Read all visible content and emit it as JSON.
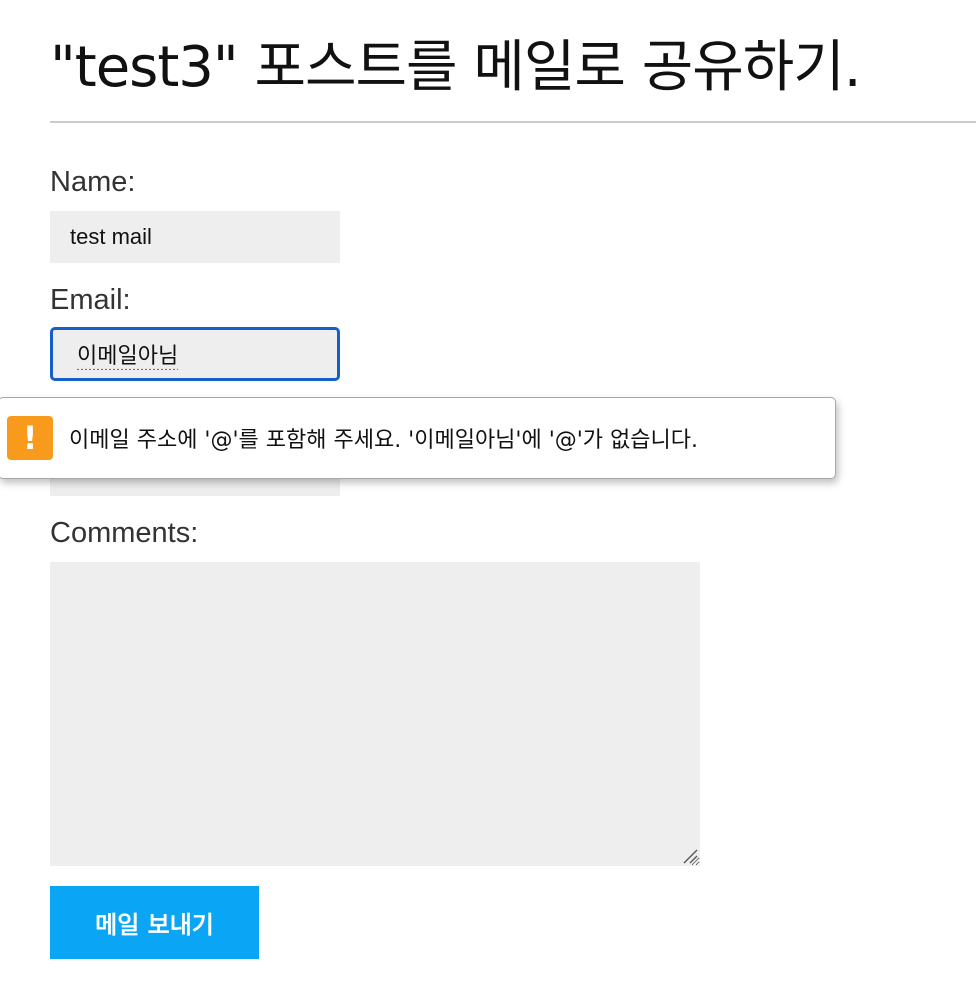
{
  "page": {
    "title": "\"test3\" 포스트를 메일로 공유하기."
  },
  "form": {
    "name_label": "Name:",
    "name_value": "test mail",
    "email_label": "Email:",
    "email_value": "이메일아님",
    "to_value": "",
    "comments_label": "Comments:",
    "comments_value": "",
    "submit_label": "메일 보내기"
  },
  "validation": {
    "icon": "warning-icon",
    "icon_glyph": "!",
    "message": "이메일 주소에 '@'를 포함해 주세요. '이메일아님'에 '@'가 없습니다."
  },
  "colors": {
    "accent_button": "#0aa6f5",
    "focus_border": "#1560c4",
    "warning": "#f89b1c",
    "field_bg": "#eeeeee"
  }
}
